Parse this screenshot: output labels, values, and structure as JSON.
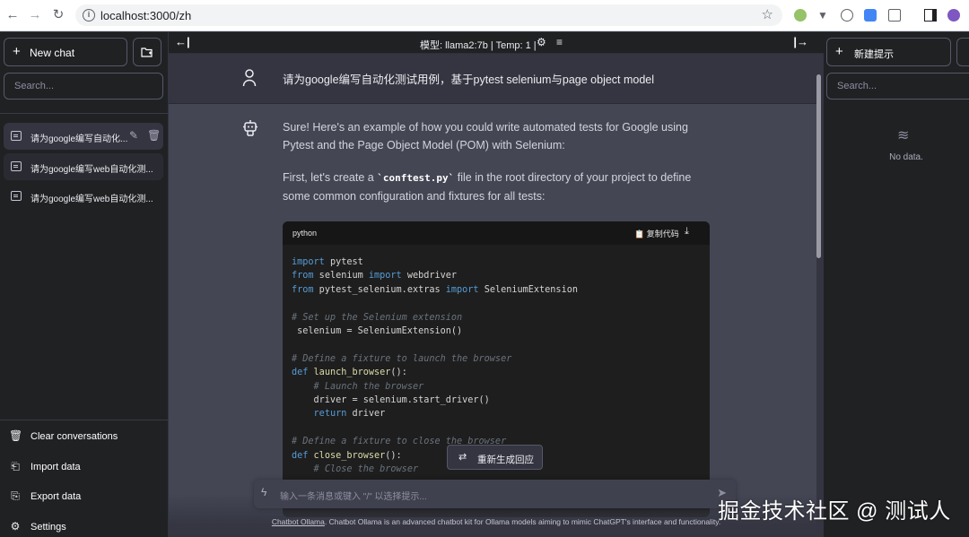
{
  "browser": {
    "url": "localhost:3000/zh"
  },
  "left_sidebar": {
    "new_chat_label": "New chat",
    "search_placeholder": "Search...",
    "conversations": [
      {
        "label": "请为google编写自动化..."
      },
      {
        "label": "请为google编写web自动化测..."
      },
      {
        "label": "请为google编写web自动化测..."
      }
    ],
    "menu": {
      "clear": "Clear conversations",
      "import": "Import data",
      "export": "Export data",
      "settings": "Settings"
    }
  },
  "topbar": {
    "model_info": "模型: llama2:7b | Temp: 1 |"
  },
  "chat": {
    "user_message": "请为google编写自动化测试用例，基于pytest selenium与page object model",
    "bot_intro": "Sure! Here's an example of how you could write automated tests for Google using Pytest and the Page Object Model (POM) with Selenium:",
    "bot_conftest_before": "First, let's create a ",
    "bot_conftest_code": "`conftest.py`",
    "bot_conftest_after": " file in the root directory of your project to define some common configuration and fixtures for all tests:",
    "code": {
      "language": "python",
      "copy_label": "复制代码"
    }
  },
  "regenerate_label": "重新生成回应",
  "input": {
    "placeholder": "输入一条消息或键入 \"/\" 以选择提示..."
  },
  "footer": {
    "link": "Chatbot Ollama",
    "text": ". Chatbot Ollama is an advanced chatbot kit for Ollama models aiming to mimic ChatGPT's interface and functionality."
  },
  "right_sidebar": {
    "new_prompt_label": "新建提示",
    "search_placeholder": "Search...",
    "empty_text": "No data."
  },
  "watermark": "掘金技术社区 @ 测试人"
}
